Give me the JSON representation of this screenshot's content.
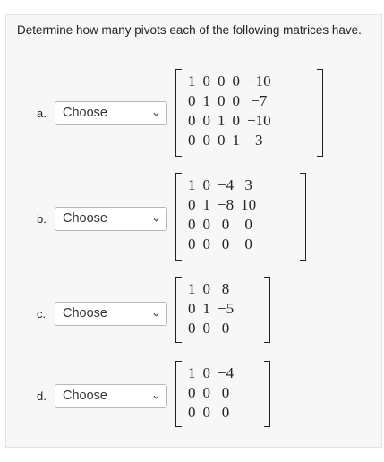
{
  "prompt": "Determine how many pivots each of the following matrices have.",
  "choose_label": "Choose",
  "items": [
    {
      "letter": "a.",
      "matrix": [
        [
          "1",
          "0",
          "0",
          "0",
          "−10"
        ],
        [
          "0",
          "1",
          "0",
          "0",
          "−7"
        ],
        [
          "0",
          "0",
          "1",
          "0",
          "−10"
        ],
        [
          "0",
          "0",
          "0",
          "1",
          "3"
        ]
      ]
    },
    {
      "letter": "b.",
      "matrix": [
        [
          "1",
          "0",
          "−4",
          "3"
        ],
        [
          "0",
          "1",
          "−8",
          "10"
        ],
        [
          "0",
          "0",
          "0",
          "0"
        ],
        [
          "0",
          "0",
          "0",
          "0"
        ]
      ]
    },
    {
      "letter": "c.",
      "matrix": [
        [
          "1",
          "0",
          "8"
        ],
        [
          "0",
          "1",
          "−5"
        ],
        [
          "0",
          "0",
          "0"
        ]
      ]
    },
    {
      "letter": "d.",
      "matrix": [
        [
          "1",
          "0",
          "−4"
        ],
        [
          "0",
          "0",
          "0"
        ],
        [
          "0",
          "0",
          "0"
        ]
      ]
    }
  ]
}
